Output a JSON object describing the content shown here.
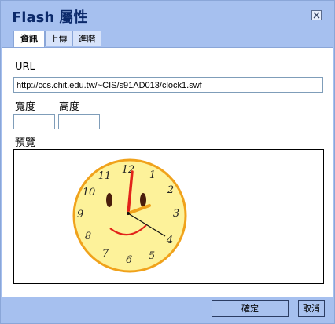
{
  "dialog": {
    "title": "Flash 屬性",
    "close_icon": "close-icon"
  },
  "tabs": [
    {
      "label": "資訊",
      "active": true
    },
    {
      "label": "上傳",
      "active": false
    },
    {
      "label": "進階",
      "active": false
    }
  ],
  "form": {
    "url_label": "URL",
    "url_value": "http://ccs.chit.edu.tw/~CIS/s91AD013/clock1.swf",
    "width_label": "寬度",
    "width_value": "",
    "height_label": "高度",
    "height_value": "",
    "preview_label": "預覽"
  },
  "preview": {
    "clock_numbers": [
      "12",
      "1",
      "2",
      "3",
      "4",
      "5",
      "6",
      "7",
      "8",
      "9",
      "10",
      "11"
    ]
  },
  "buttons": {
    "ok_label": "確定",
    "cancel_label": "取消"
  },
  "colors": {
    "title_bar": "#a6c0ef",
    "accent": "#0c2a6b",
    "clock_face": "#fdf29a",
    "clock_rim": "#f0a21b"
  }
}
